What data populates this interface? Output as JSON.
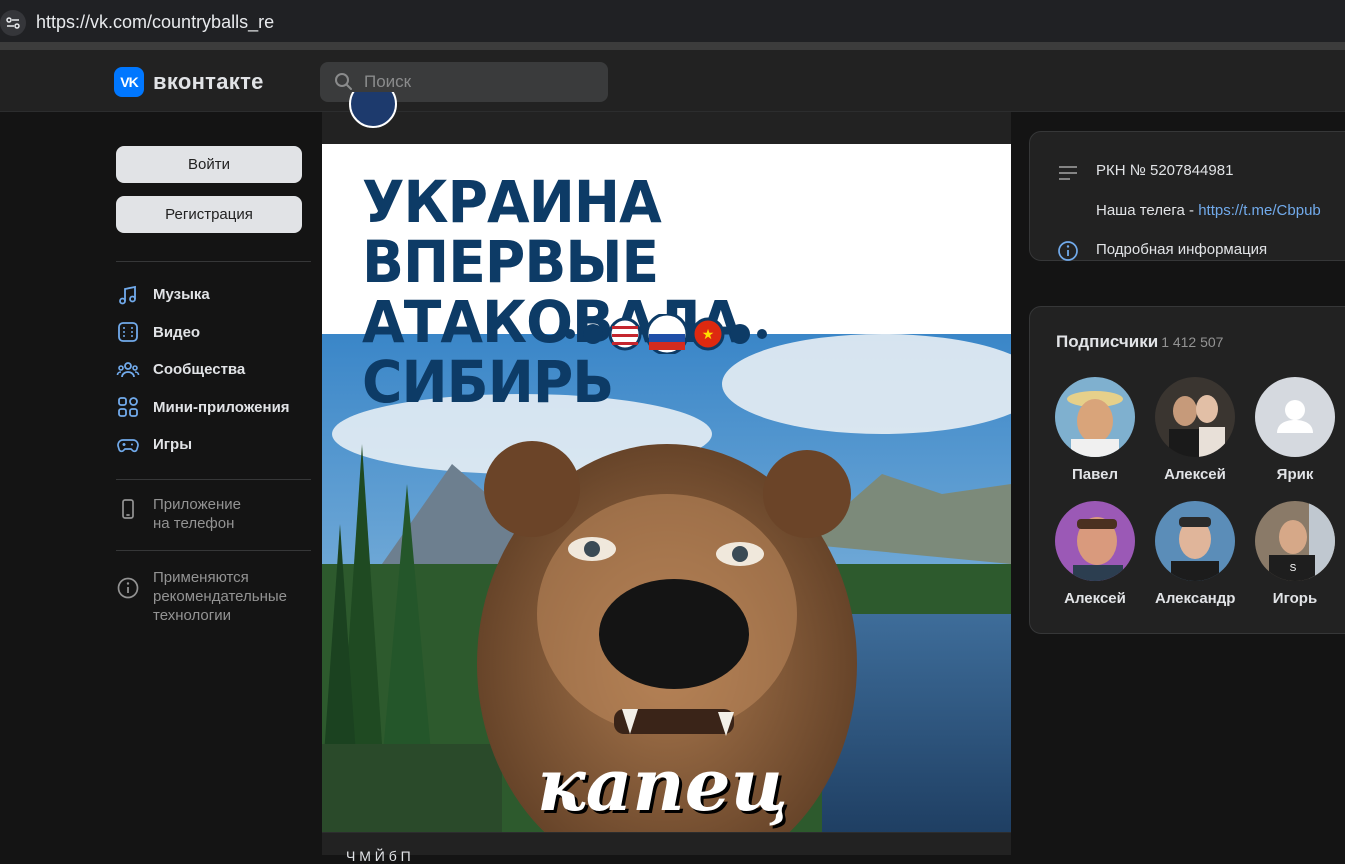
{
  "browser": {
    "url": "https://vk.com/countryballs_re"
  },
  "header": {
    "logo_mark": "VK",
    "logo_text": "вконтакте",
    "search_placeholder": "Поиск"
  },
  "sidebar": {
    "login_label": "Войти",
    "register_label": "Регистрация",
    "nav": [
      {
        "label": "Музыка",
        "icon": "music-icon"
      },
      {
        "label": "Видео",
        "icon": "video-icon"
      },
      {
        "label": "Сообщества",
        "icon": "communities-icon"
      },
      {
        "label": "Мини-приложения",
        "icon": "mini-apps-icon"
      },
      {
        "label": "Игры",
        "icon": "games-icon"
      }
    ],
    "app_line1": "Приложение",
    "app_line2": "на телефон",
    "rec_line1": "Применяются",
    "rec_line2": "рекомендательные",
    "rec_line3": "технологии"
  },
  "post": {
    "headline_line1": "УКРАИНА ВПЕРВЫЕ",
    "headline_line2": "АТАКОВАЛА СИБИРЬ",
    "caption": "капец",
    "footer_text": "Ч                                                     М                 Й               б         П"
  },
  "info": {
    "rkn": "РКН № 5207844981",
    "telegram_prefix": "Наша телега - ",
    "telegram_link": "https://t.me/Cbpub",
    "more_info": "Подробная информация"
  },
  "subscribers": {
    "title": "Подписчики",
    "count": "1 412 507",
    "people": [
      {
        "name": "Павел",
        "color": "#c78a4a"
      },
      {
        "name": "Алексей",
        "color": "#5a4a3e"
      },
      {
        "name": "Ярик",
        "color": "#d5d9df"
      },
      {
        "name": "Алексей",
        "color": "#a86ab5"
      },
      {
        "name": "Александр",
        "color": "#3d6a8a"
      },
      {
        "name": "Игорь",
        "color": "#6b5a4a"
      }
    ]
  },
  "colors": {
    "accent": "#0077ff",
    "link": "#71aaeb",
    "headline": "#0d3b66"
  }
}
